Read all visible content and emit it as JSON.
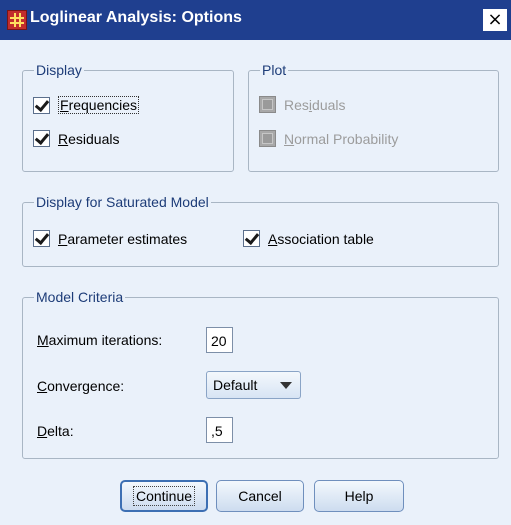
{
  "window": {
    "title": "Loglinear Analysis: Options",
    "close_label": "×",
    "icon": "spss-grid-icon"
  },
  "display": {
    "legend": "Display",
    "items": [
      {
        "label": "Frequencies",
        "mnemonic": "F",
        "rest": "requencies",
        "checked": true
      },
      {
        "label": "Residuals",
        "mnemonic": "R",
        "rest": "esiduals",
        "checked": true
      }
    ]
  },
  "plot": {
    "legend": "Plot",
    "items": [
      {
        "label": "Residuals",
        "pre": "Res",
        "mnemonic": "i",
        "rest": "duals",
        "checked": false,
        "enabled": false
      },
      {
        "label": "Normal Probability",
        "mnemonic": "N",
        "rest": "ormal Probability",
        "checked": false,
        "enabled": false
      }
    ]
  },
  "saturated": {
    "legend": "Display for Saturated Model",
    "items": [
      {
        "label": "Parameter estimates",
        "mnemonic": "P",
        "rest": "arameter estimates",
        "checked": true
      },
      {
        "label": "Association table",
        "mnemonic": "A",
        "rest": "ssociation table",
        "checked": true
      }
    ]
  },
  "criteria": {
    "legend": "Model Criteria",
    "max_iter_label": {
      "mnemonic": "M",
      "rest": "aximum iterations:"
    },
    "max_iter_value": "20",
    "convergence_label": {
      "mnemonic": "C",
      "rest": "onvergence:"
    },
    "convergence_value": "Default",
    "delta_label": {
      "mnemonic": "D",
      "rest": "elta:"
    },
    "delta_value": ",5"
  },
  "buttons": {
    "continue": "Continue",
    "cancel": "Cancel",
    "help": "Help"
  }
}
